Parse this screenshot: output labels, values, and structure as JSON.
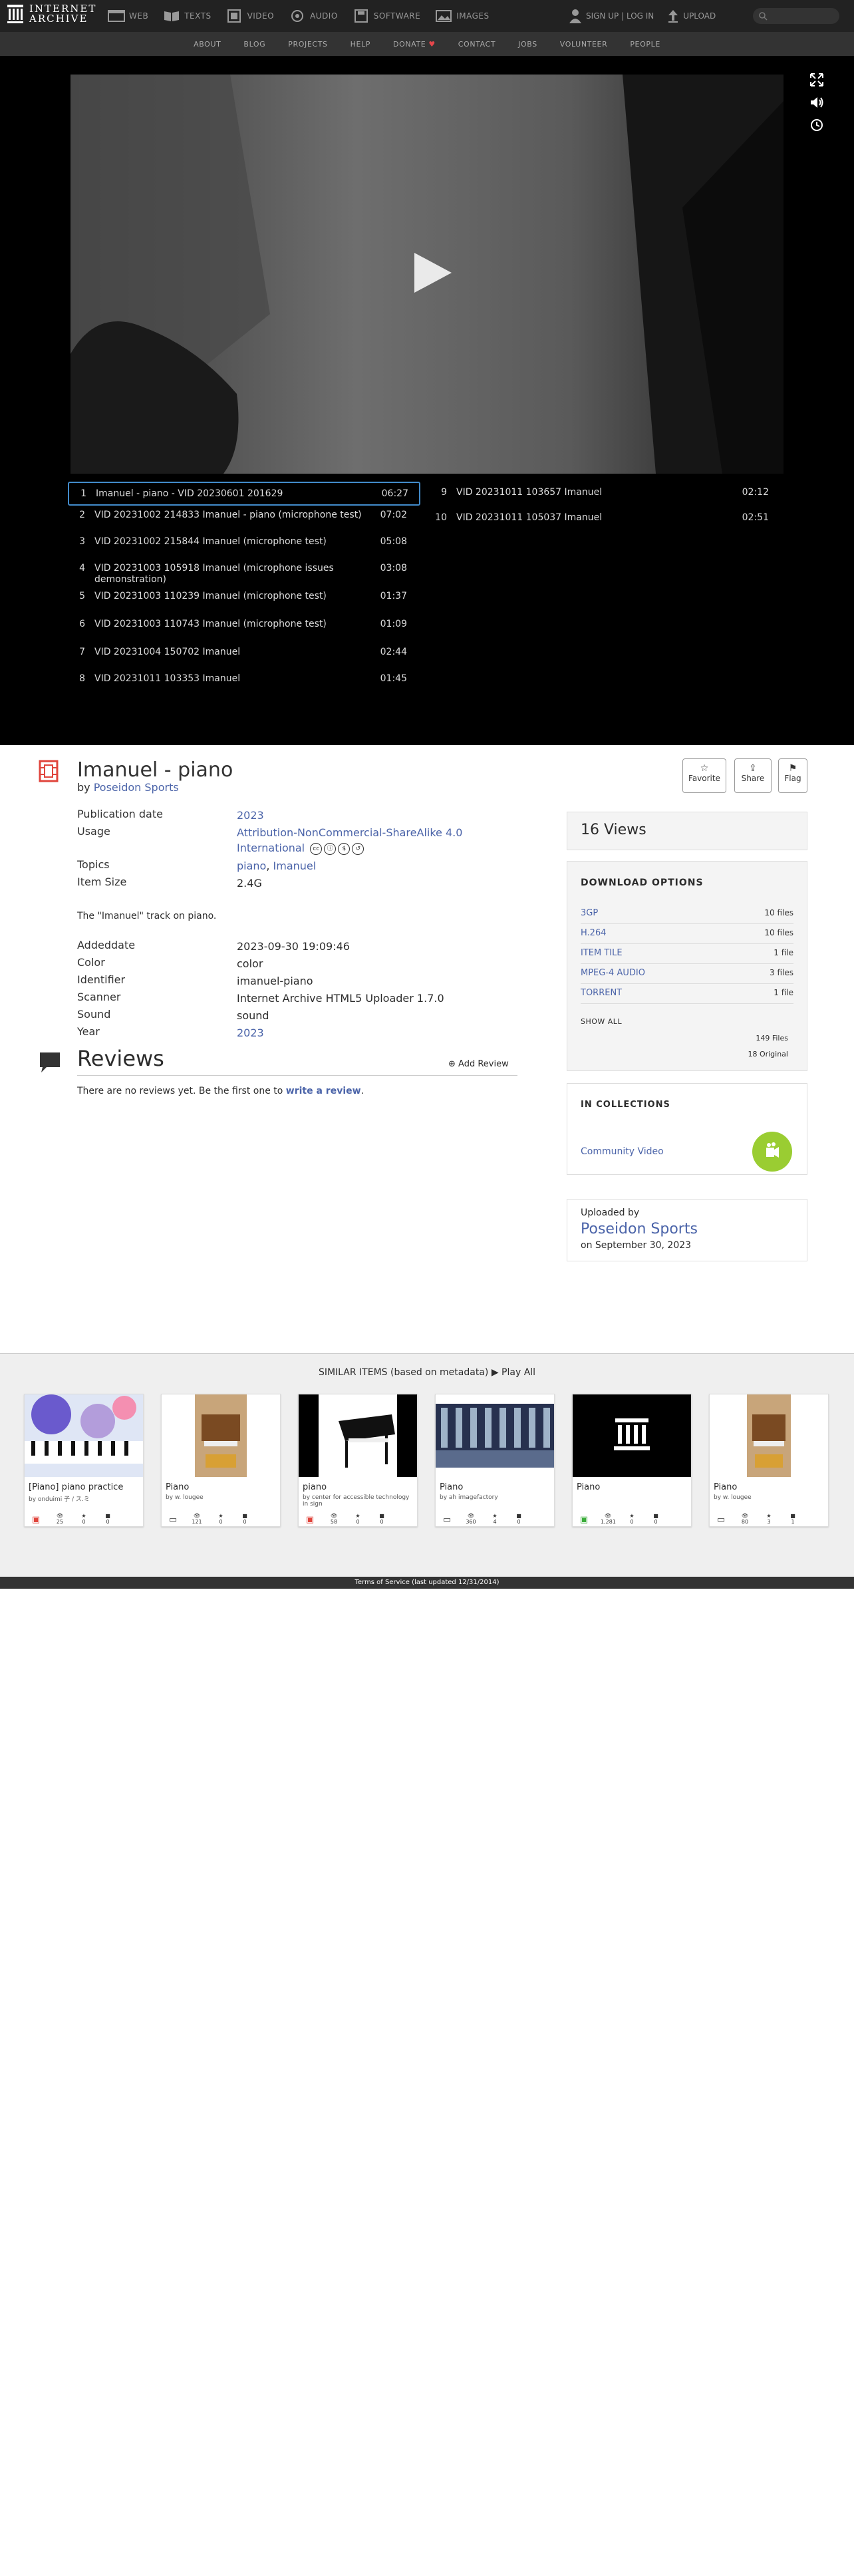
{
  "topnav": {
    "logo_line1": "INTERNET",
    "logo_line2": "ARCHIVE",
    "media": [
      "WEB",
      "TEXTS",
      "VIDEO",
      "AUDIO",
      "SOFTWARE",
      "IMAGES"
    ],
    "signup": "SIGN UP | LOG IN",
    "upload": "UPLOAD"
  },
  "subnav": [
    "ABOUT",
    "BLOG",
    "PROJECTS",
    "HELP",
    "DONATE",
    "CONTACT",
    "JOBS",
    "VOLUNTEER",
    "PEOPLE"
  ],
  "playlist": [
    {
      "n": "1",
      "title": "Imanuel - piano - VID 20230601 201629",
      "dur": "06:27"
    },
    {
      "n": "2",
      "title": "VID 20231002 214833 Imanuel - piano (microphone test)",
      "dur": "07:02"
    },
    {
      "n": "3",
      "title": "VID 20231002 215844 Imanuel (microphone test)",
      "dur": "05:08"
    },
    {
      "n": "4",
      "title": "VID 20231003 105918 Imanuel (microphone issues demonstration)",
      "dur": "03:08"
    },
    {
      "n": "5",
      "title": "VID 20231003 110239 Imanuel (microphone test)",
      "dur": "01:37"
    },
    {
      "n": "6",
      "title": "VID 20231003 110743 Imanuel (microphone test)",
      "dur": "01:09"
    },
    {
      "n": "7",
      "title": "VID 20231004 150702 Imanuel",
      "dur": "02:44"
    },
    {
      "n": "8",
      "title": "VID 20231011 103353 Imanuel",
      "dur": "01:45"
    },
    {
      "n": "9",
      "title": "VID 20231011 103657 Imanuel",
      "dur": "02:12"
    },
    {
      "n": "10",
      "title": "VID 20231011 105037 Imanuel",
      "dur": "02:51"
    }
  ],
  "item": {
    "title": "Imanuel - piano",
    "by_label": "by",
    "by": "Poseidon Sports",
    "actions": [
      "Favorite",
      "Share",
      "Flag"
    ],
    "pubdate_k": "Publication date",
    "pubdate_v": "2023",
    "usage_k": "Usage",
    "usage_v": "Attribution-NonCommercial-ShareAlike 4.0 International",
    "topics_k": "Topics",
    "topic1": "piano",
    "topic2": "Imanuel",
    "size_k": "Item Size",
    "size_v": "2.4G",
    "description": "The \"Imanuel\" track on piano.",
    "addeddate_k": "Addeddate",
    "addeddate_v": "2023-09-30 19:09:46",
    "color_k": "Color",
    "color_v": "color",
    "identifier_k": "Identifier",
    "identifier_v": "imanuel-piano",
    "scanner_k": "Scanner",
    "scanner_v": "Internet Archive HTML5 Uploader 1.7.0",
    "sound_k": "Sound",
    "sound_v": "sound",
    "year_k": "Year",
    "year_v": "2023"
  },
  "reviews": {
    "heading": "Reviews",
    "add": "Add Review",
    "none_text": "There are no reviews yet. Be the first one to",
    "write": "write a review"
  },
  "views": "16 Views",
  "downloads": {
    "heading": "DOWNLOAD OPTIONS",
    "items": [
      {
        "fmt": "3GP",
        "count": "10 files"
      },
      {
        "fmt": "H.264",
        "count": "10 files"
      },
      {
        "fmt": "ITEM TILE",
        "count": "1 file"
      },
      {
        "fmt": "MPEG-4 AUDIO",
        "count": "3 files"
      },
      {
        "fmt": "TORRENT",
        "count": "1 file"
      }
    ],
    "show_all": "SHOW ALL",
    "total_files": "149 Files",
    "original": "18 Original"
  },
  "collections": {
    "heading": "IN COLLECTIONS",
    "name": "Community Video"
  },
  "uploader": {
    "label": "Uploaded by",
    "name": "Poseidon Sports",
    "date": "on September 30, 2023"
  },
  "similar": {
    "heading": "SIMILAR ITEMS (based on metadata)",
    "play_all": "Play All",
    "cards": [
      {
        "title": "[Piano] piano practice",
        "by": "by onduimi 子 / ス.ミ",
        "views": "25",
        "favs": "0",
        "reviews": "0"
      },
      {
        "title": "Piano",
        "by": "by w. lougee",
        "views": "121",
        "favs": "0",
        "reviews": "0"
      },
      {
        "title": "piano",
        "by": "by center for accessible technology in sign",
        "views": "58",
        "favs": "0",
        "reviews": "0"
      },
      {
        "title": "Piano",
        "by": "by ah imagefactory",
        "views": "360",
        "favs": "4",
        "reviews": "0"
      },
      {
        "title": "Piano",
        "by": "",
        "views": "1,281",
        "favs": "0",
        "reviews": "0"
      },
      {
        "title": "Piano",
        "by": "by w. lougee",
        "views": "80",
        "favs": "3",
        "reviews": "1"
      }
    ]
  },
  "footer": "Terms of Service (last updated 12/31/2014)"
}
